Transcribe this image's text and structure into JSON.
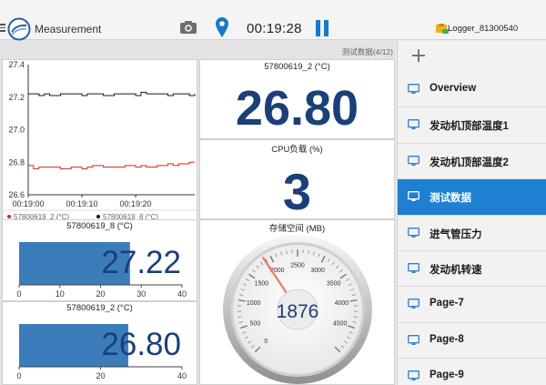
{
  "header": {
    "app_title": "Measurement",
    "timer": "00:19:28",
    "logger_name": "Logger_81300540",
    "colors": {
      "accent": "#1979c9",
      "value_text": "#1b3f78"
    }
  },
  "dashboard": {
    "page_indicator": "测试数据(4/12)",
    "big_panels": [
      {
        "title": "57800619_2 (°C)",
        "value": "26.80"
      },
      {
        "title": "CPU负载 (%)",
        "value": "3"
      }
    ],
    "gauge": {
      "title": "存储空间 (MB)",
      "value": "1876",
      "value_num": 1876,
      "min": 0,
      "max": 5000,
      "ticks": [
        "0",
        "500",
        "1000",
        "1500",
        "2000",
        "2500",
        "3000",
        "3500",
        "4000",
        "4500"
      ]
    },
    "bar_panels": [
      {
        "title": "57800619_8 (°C)",
        "value": "27.22",
        "value_num": 27.22,
        "axis_max": 40,
        "ticks": [
          "0",
          "10",
          "20",
          "30",
          "40"
        ]
      },
      {
        "title": "57800619_2 (°C)",
        "value": "26.80",
        "value_num": 26.8,
        "axis_max": 40,
        "ticks": [
          "0",
          "20",
          "40"
        ]
      }
    ]
  },
  "chart_data": {
    "type": "line",
    "y_ticks": [
      "27.4",
      "27.2",
      "27.0",
      "26.8",
      "26.6"
    ],
    "ylim": [
      26.6,
      27.4
    ],
    "x_ticks": [
      "00:19:00",
      "00:19:10",
      "00:19:20"
    ],
    "xlim": [
      0,
      31
    ],
    "x_tick_positions": [
      0,
      10,
      20
    ],
    "series": [
      {
        "name": "57800619_2 (°C)",
        "color": "#e02020",
        "x": [
          0,
          1,
          2,
          4,
          6,
          8,
          10,
          11,
          12,
          14,
          16,
          18,
          20,
          21,
          22,
          24,
          26,
          27,
          28,
          30,
          31
        ],
        "y": [
          26.78,
          26.76,
          26.77,
          26.77,
          26.76,
          26.77,
          26.76,
          26.77,
          26.78,
          26.77,
          26.77,
          26.78,
          26.77,
          26.78,
          26.77,
          26.78,
          26.79,
          26.78,
          26.79,
          26.8,
          26.8
        ]
      },
      {
        "name": "57800619_8 (°C)",
        "color": "#1a1a1a",
        "x": [
          0,
          2,
          3,
          4,
          6,
          8,
          10,
          11,
          12,
          14,
          16,
          18,
          20,
          21,
          22,
          24,
          26,
          27,
          28,
          30,
          31
        ],
        "y": [
          27.22,
          27.21,
          27.22,
          27.21,
          27.22,
          27.22,
          27.21,
          27.22,
          27.22,
          27.21,
          27.22,
          27.22,
          27.21,
          27.23,
          27.22,
          27.22,
          27.21,
          27.22,
          27.22,
          27.21,
          27.22
        ]
      }
    ]
  },
  "sidebar": {
    "items": [
      {
        "label": "Overview",
        "active": false
      },
      {
        "label": "发动机顶部温度1",
        "active": false
      },
      {
        "label": "发动机顶部温度2",
        "active": false
      },
      {
        "label": "测试数据",
        "active": true
      },
      {
        "label": "进气管压力",
        "active": false
      },
      {
        "label": "发动机转速",
        "active": false
      },
      {
        "label": "Page-7",
        "active": false
      },
      {
        "label": "Page-8",
        "active": false
      },
      {
        "label": "Page-9",
        "active": false
      }
    ]
  }
}
